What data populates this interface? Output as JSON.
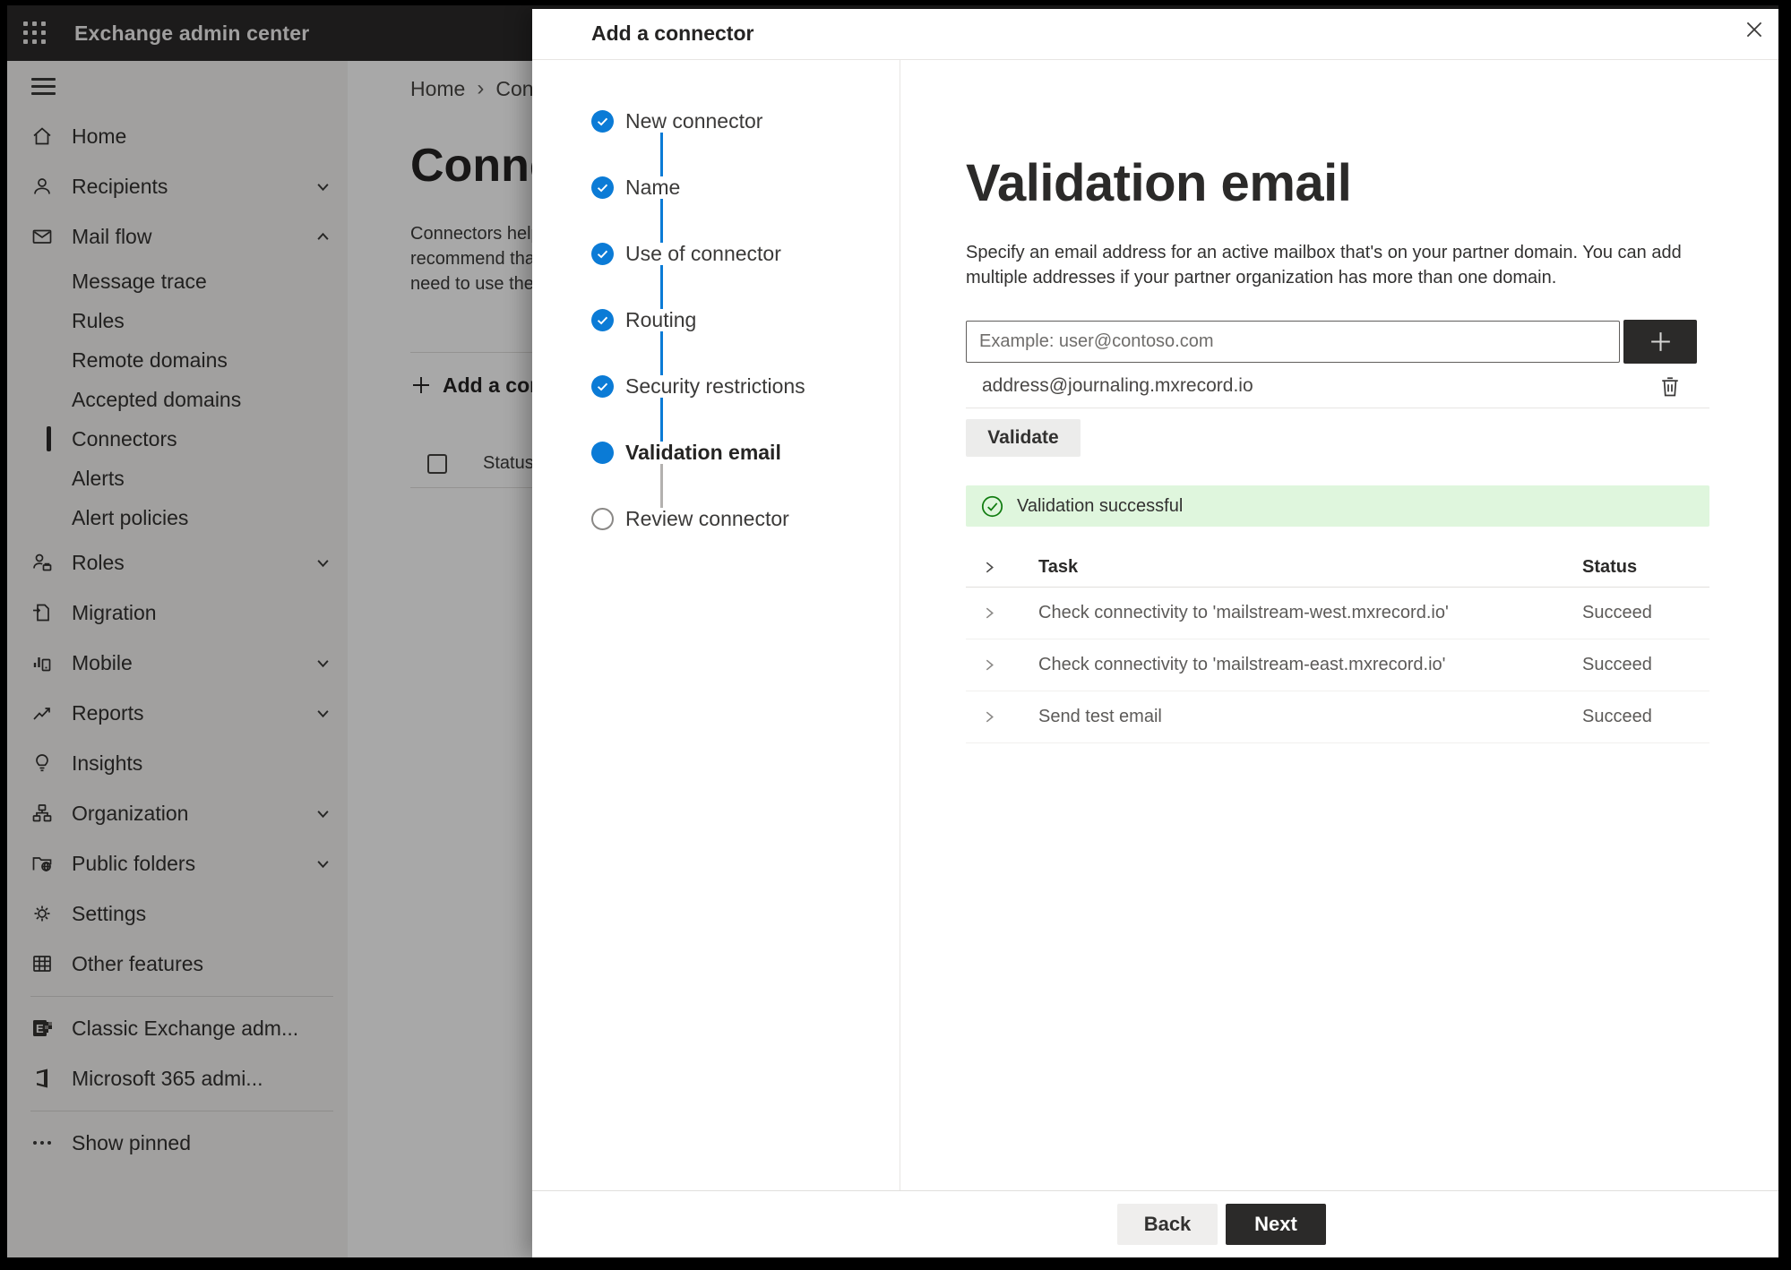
{
  "colors": {
    "accent_blue": "#0b7bd6",
    "success_bg": "#dff6dd",
    "success_green": "#107c10",
    "dark_button": "#2b2a29",
    "topbar_bg": "#2b2a29",
    "sidebar_bg": "#f4f3f1"
  },
  "topbar": {
    "title": "Exchange admin center"
  },
  "sidebar": {
    "items": [
      {
        "label": "Home"
      },
      {
        "label": "Recipients",
        "chevron": "down"
      },
      {
        "label": "Mail flow",
        "chevron": "up"
      },
      {
        "label": "Message trace"
      },
      {
        "label": "Rules"
      },
      {
        "label": "Remote domains"
      },
      {
        "label": "Accepted domains"
      },
      {
        "label": "Connectors",
        "selected": true
      },
      {
        "label": "Alerts"
      },
      {
        "label": "Alert policies"
      },
      {
        "label": "Roles",
        "chevron": "down"
      },
      {
        "label": "Migration"
      },
      {
        "label": "Mobile",
        "chevron": "down"
      },
      {
        "label": "Reports",
        "chevron": "down"
      },
      {
        "label": "Insights"
      },
      {
        "label": "Organization",
        "chevron": "down"
      },
      {
        "label": "Public folders",
        "chevron": "down"
      },
      {
        "label": "Settings"
      },
      {
        "label": "Other features"
      },
      {
        "label": "Classic Exchange adm..."
      },
      {
        "label": "Microsoft 365 admi..."
      },
      {
        "label": "Show pinned"
      }
    ]
  },
  "page": {
    "breadcrumb": {
      "home": "Home",
      "separator": "›",
      "current": "Connectors"
    },
    "title": "Connectors",
    "paragraph_lines": [
      "Connectors help control the flow of email",
      "recommend that you check if you really",
      "need to use them."
    ],
    "add_button": "Add a connector",
    "status_header": "Status"
  },
  "panel": {
    "title": "Add a connector",
    "steps": [
      {
        "label": "New connector",
        "state": "done"
      },
      {
        "label": "Name",
        "state": "done"
      },
      {
        "label": "Use of connector",
        "state": "done"
      },
      {
        "label": "Routing",
        "state": "done"
      },
      {
        "label": "Security restrictions",
        "state": "done"
      },
      {
        "label": "Validation email",
        "state": "current"
      },
      {
        "label": "Review connector",
        "state": "todo"
      }
    ],
    "heading": "Validation email",
    "description": "Specify an email address for an active mailbox that's on your partner domain. You can add multiple addresses if your partner organization has more than one domain.",
    "email_input": {
      "value": "",
      "placeholder": "Example: user@contoso.com"
    },
    "addresses": [
      "address@journaling.mxrecord.io"
    ],
    "validate_button": "Validate",
    "success_message": "Validation successful",
    "table": {
      "headers": {
        "task": "Task",
        "status": "Status"
      },
      "rows": [
        {
          "task": "Check connectivity to 'mailstream-west.mxrecord.io'",
          "status": "Succeed"
        },
        {
          "task": "Check connectivity to 'mailstream-east.mxrecord.io'",
          "status": "Succeed"
        },
        {
          "task": "Send test email",
          "status": "Succeed"
        }
      ]
    },
    "back_button": "Back",
    "next_button": "Next"
  }
}
